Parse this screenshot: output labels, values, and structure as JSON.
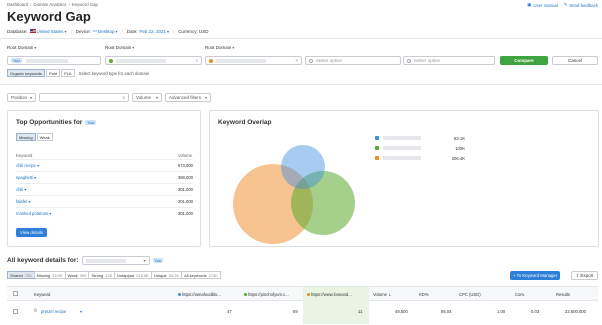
{
  "breadcrumb": [
    "Dashboard",
    "Domain Analytics",
    "Keyword Gap"
  ],
  "header_links": {
    "user_manual": "User manual",
    "send_feedback": "Send feedback"
  },
  "page_title": "Keyword Gap",
  "filters": {
    "database_label": "Database:",
    "database_value": "United States",
    "device_label": "Device:",
    "device_value": "Desktop",
    "date_label": "Date:",
    "date_value": "Feb 22, 2021",
    "currency_label": "Currency: USD"
  },
  "domains": {
    "root_domain_label": "Root Domain",
    "you_badge": "You",
    "select_option": "Select option",
    "compare": "Compare",
    "cancel": "Cancel"
  },
  "keyword_types": {
    "organic": "Organic keywords",
    "paid": "Paid",
    "pla": "PLA",
    "hint": "Select keyword type for each domain"
  },
  "toolbar": {
    "position": "Position",
    "volume": "Volume",
    "advanced": "Advanced filters"
  },
  "opportunities": {
    "title": "Top Opportunities for",
    "badge": "You",
    "tabs": [
      "Missing",
      "Weak"
    ],
    "col_keyword": "Keyword",
    "col_volume": "Volume",
    "rows": [
      {
        "keyword": "chili recipe",
        "volume": "673,000"
      },
      {
        "keyword": "spaghetti",
        "volume": "368,000"
      },
      {
        "keyword": "chili",
        "volume": "301,000"
      },
      {
        "keyword": "falafel",
        "volume": "301,000"
      },
      {
        "keyword": "mashed potatoes",
        "volume": "301,000"
      }
    ],
    "view_details": "View details"
  },
  "overlap": {
    "title": "Keyword Overlap",
    "legend": [
      {
        "value": "63.1K",
        "color": "#3d8fe0"
      },
      {
        "value": "100K",
        "color": "#5aaa2e"
      },
      {
        "value": "206.4K",
        "color": "#f08a24"
      }
    ]
  },
  "details": {
    "title": "All keyword details for:",
    "badge": "You",
    "to_manager": "+ To Keyword Manager",
    "export": "Export",
    "segments": [
      {
        "label": "Shared",
        "count": "755"
      },
      {
        "label": "Missing",
        "count": "23.9K"
      },
      {
        "label": "Weak",
        "count": "399"
      },
      {
        "label": "Strong",
        "count": "126"
      },
      {
        "label": "Untapped",
        "count": "210.5K"
      },
      {
        "label": "Unique",
        "count": "34.2K"
      },
      {
        "label": "All keywords",
        "count": "274K"
      }
    ],
    "columns": {
      "keyword": "Keyword",
      "d1": "https://iamafoodblo...",
      "d2": "https://pinchofyum.c...",
      "d3": "https://www.loveand...",
      "volume": "Volume",
      "kd": "KD%",
      "cpc": "CPC (USD)",
      "com": "Com.",
      "results": "Results"
    },
    "rows": [
      {
        "keyword": "pretzel recipe",
        "d1": "47",
        "d2": "69",
        "d3": "11",
        "volume": "49,500",
        "kd": "85.04",
        "cpc": "1.00",
        "com": "0.03",
        "results": "22,500,000"
      }
    ]
  }
}
